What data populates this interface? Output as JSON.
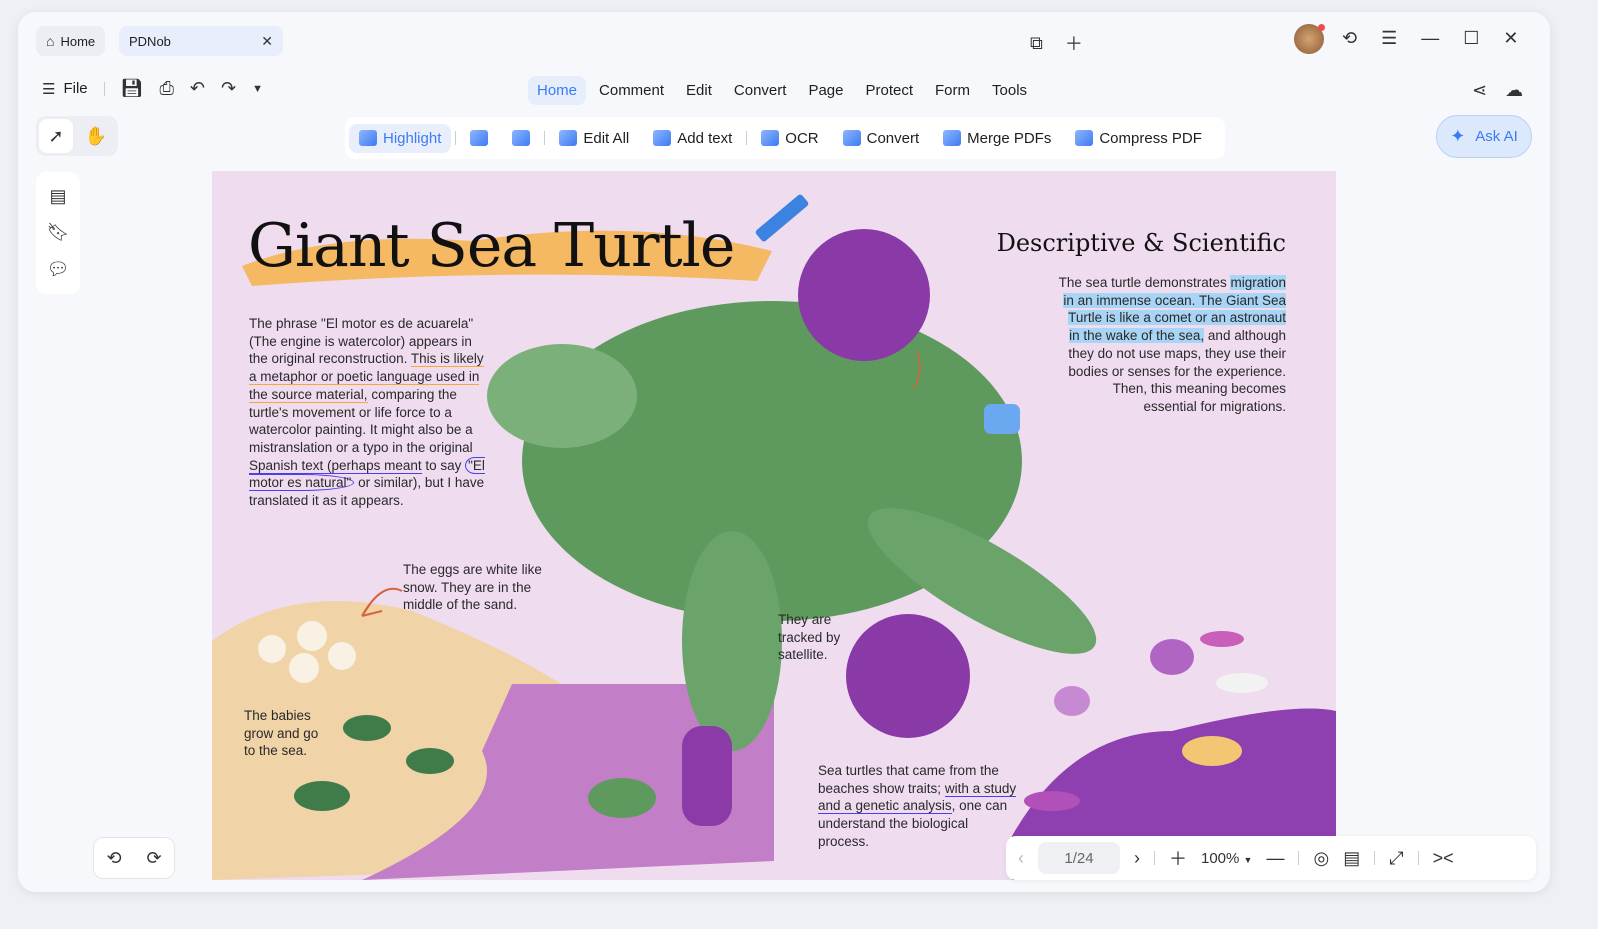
{
  "tabs": {
    "home": "Home",
    "doc": "PDNob"
  },
  "toolbar_left": {
    "file": "File"
  },
  "menu": [
    "Home",
    "Comment",
    "Edit",
    "Convert",
    "Page",
    "Protect",
    "Form",
    "Tools"
  ],
  "tools": {
    "highlight": "Highlight",
    "edit_all": "Edit All",
    "add_text": "Add text",
    "ocr": "OCR",
    "convert": "Convert",
    "merge": "Merge PDFs",
    "compress": "Compress PDF"
  },
  "ask_ai": "Ask AI",
  "doc": {
    "title": "Giant Sea Turtle",
    "left": {
      "p1": "The phrase \"El motor es de acuarela\" (The engine is watercolor) appears in the original reconstruction. ",
      "u1": "This is likely a metaphor or poetic language used in the source material,",
      "p2": " comparing the turtle's movement or life force to a watercolor painting. It might also be a mistranslation or a typo in the original ",
      "u2": "Spanish text (perhaps meant",
      "p3": " to say ",
      "c1": "\"El motor es natural\"",
      "p4": " or similar), but I have translated it as it appears."
    },
    "eggs": "The eggs are white like snow. They are in the middle of the sand.",
    "babies": "The babies grow and go to the sea.",
    "satellite": "They are tracked by satellite.",
    "bottom": {
      "p1": "Sea turtles that came from the beaches show traits; ",
      "u1": "with a study and a genetic analysis",
      "p2": ", one can understand the biological process."
    },
    "right": {
      "heading": "Descriptive & Scientific",
      "p1": "The sea turtle demonstrates ",
      "h1": "migration in an immense ocean. The Giant Sea Turtle is like a comet or an astronaut in the wake of the sea,",
      "p2": " and although they do not use maps, they use their bodies or senses for the experience. Then, this meaning becomes essential for migrations."
    }
  },
  "pager": {
    "page": "1/24",
    "zoom": "100%"
  },
  "colors": {
    "accent": "#3c7bf2",
    "page_bg": "#efdcef",
    "purple": "#8a3aa6",
    "turtle": "#5e9a5e"
  }
}
